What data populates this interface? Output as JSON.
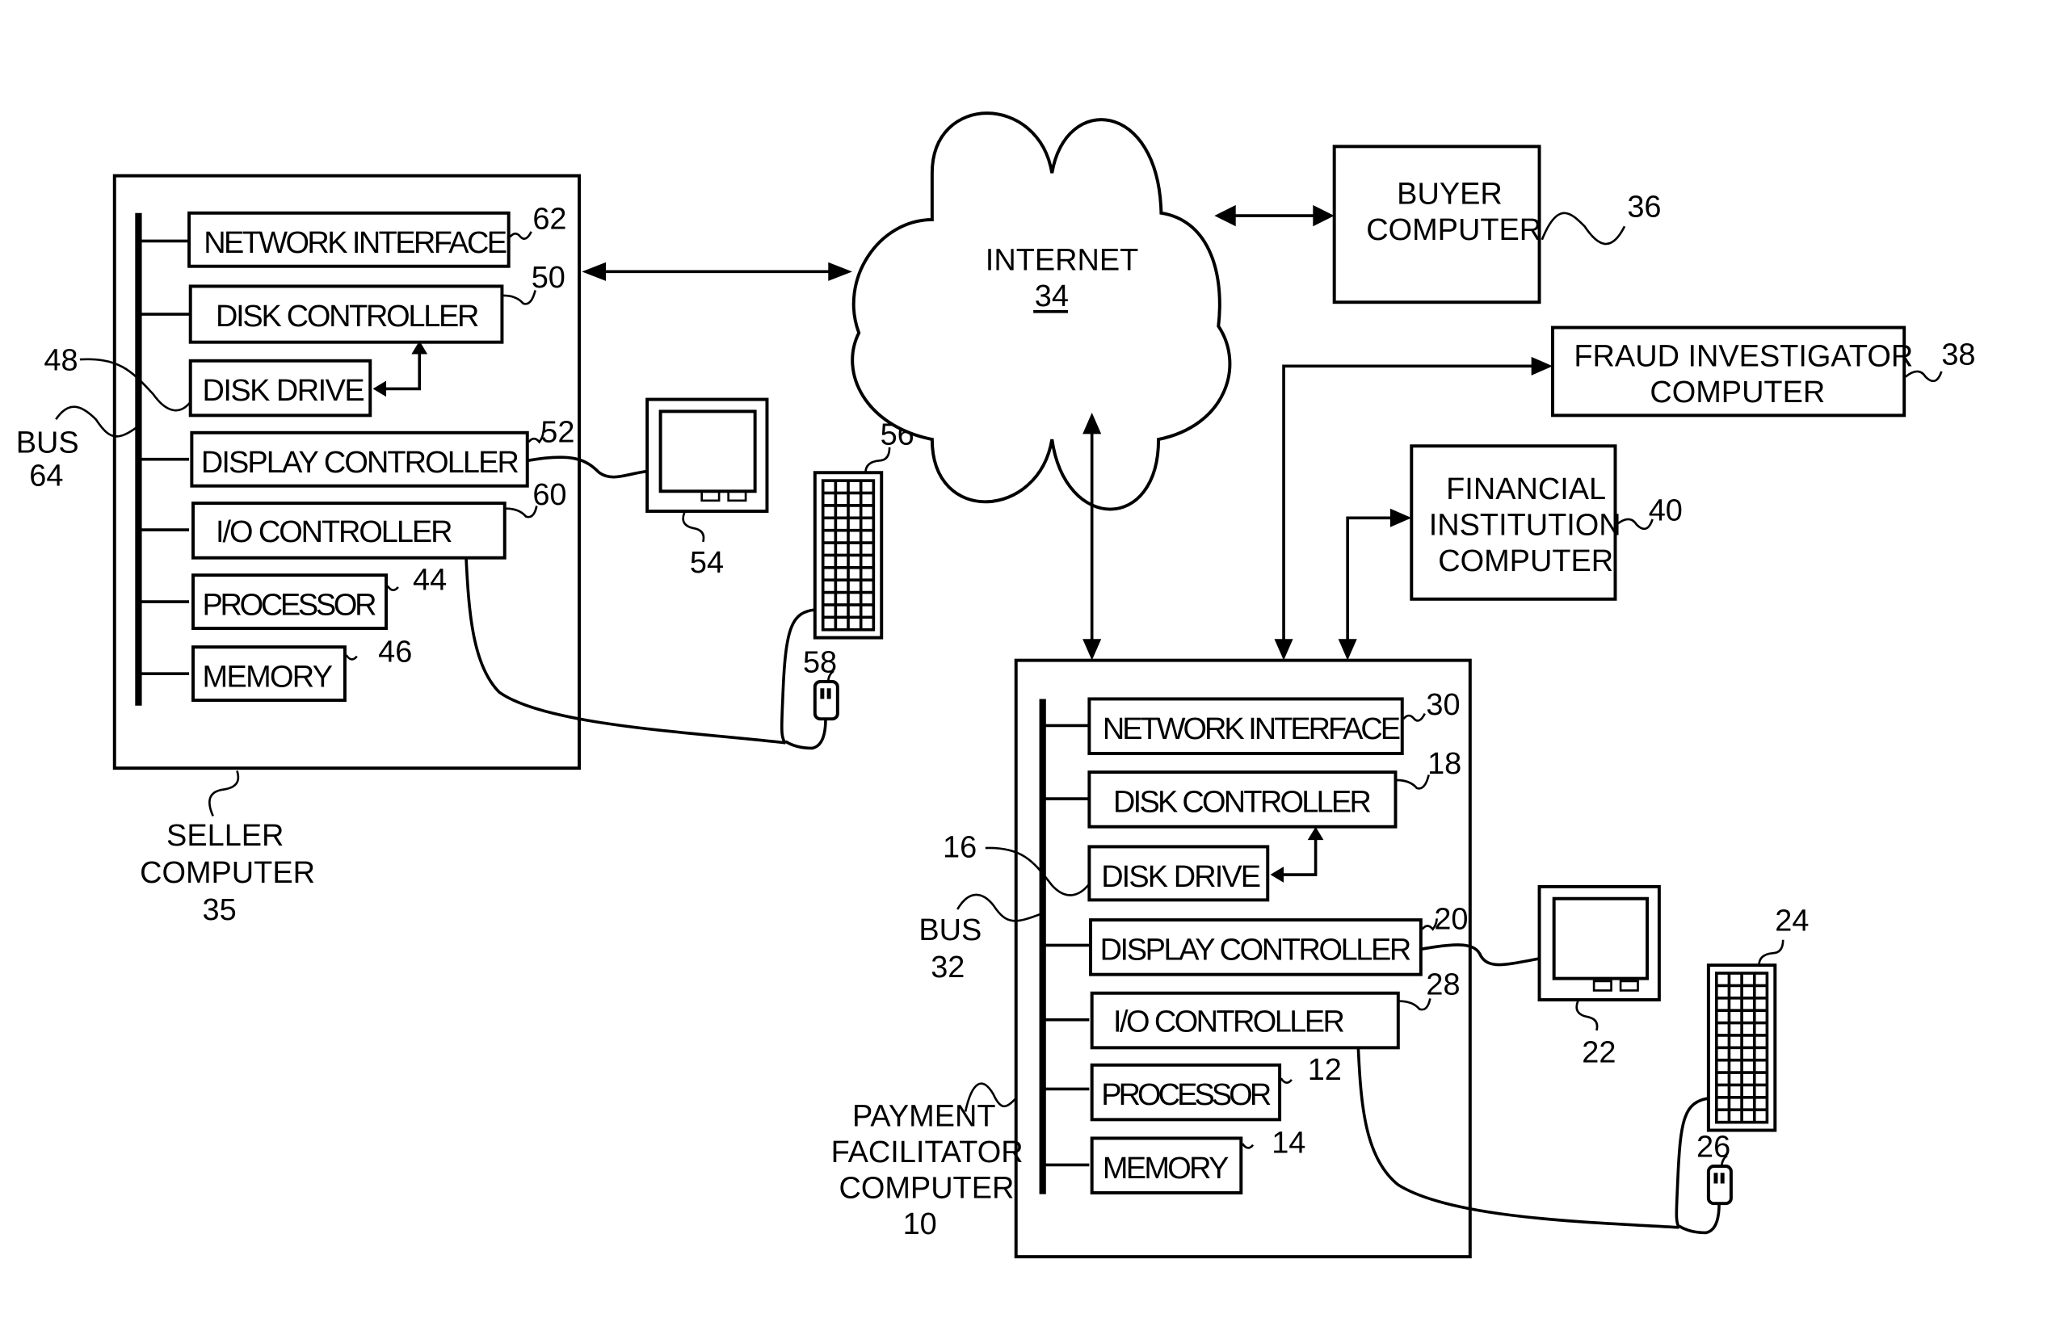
{
  "figure": {
    "internet": {
      "label": "INTERNET",
      "ref": "34"
    },
    "buyer": {
      "lines": [
        "BUYER",
        "COMPUTER"
      ],
      "ref": "36"
    },
    "fraud": {
      "lines": [
        "FRAUD INVESTIGATOR",
        "COMPUTER"
      ],
      "ref": "38"
    },
    "financial": {
      "lines": [
        "FINANCIAL",
        "INSTITUTION",
        "COMPUTER"
      ],
      "ref": "40"
    },
    "seller": {
      "caption": [
        "SELLER",
        "COMPUTER",
        "35"
      ],
      "bus": [
        "BUS",
        "64"
      ],
      "disk_drive_ref": "48",
      "components": [
        {
          "label": "NETWORK INTERFACE",
          "ref": "62"
        },
        {
          "label": "DISK CONTROLLER",
          "ref": "50"
        },
        {
          "label": "DISK DRIVE",
          "ref": "48"
        },
        {
          "label": "DISPLAY CONTROLLER",
          "ref": "52"
        },
        {
          "label": "I/O CONTROLLER",
          "ref": "60"
        },
        {
          "label": "PROCESSOR",
          "ref": "44"
        },
        {
          "label": "MEMORY",
          "ref": "46"
        }
      ],
      "monitor_ref": "54",
      "keyboard_ref": "56",
      "mouse_ref": "58"
    },
    "payment": {
      "caption": [
        "PAYMENT",
        "FACILITATOR",
        "COMPUTER",
        "10"
      ],
      "bus": [
        "BUS",
        "32"
      ],
      "disk_drive_ref": "16",
      "components": [
        {
          "label": "NETWORK INTERFACE",
          "ref": "30"
        },
        {
          "label": "DISK CONTROLLER",
          "ref": "18"
        },
        {
          "label": "DISK DRIVE",
          "ref": "16"
        },
        {
          "label": "DISPLAY CONTROLLER",
          "ref": "20"
        },
        {
          "label": "I/O CONTROLLER",
          "ref": "28"
        },
        {
          "label": "PROCESSOR",
          "ref": "12"
        },
        {
          "label": "MEMORY",
          "ref": "14"
        }
      ],
      "monitor_ref": "22",
      "keyboard_ref": "24",
      "mouse_ref": "26"
    }
  }
}
